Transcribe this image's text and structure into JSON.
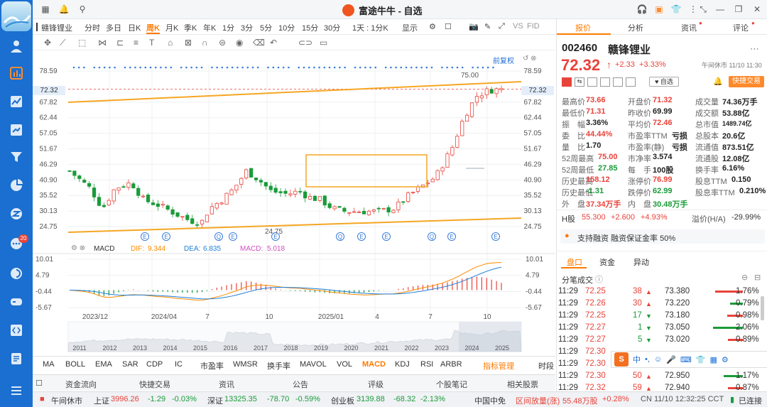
{
  "window": {
    "title": "富途牛牛 - 自选"
  },
  "rail": {
    "badge": "20"
  },
  "chart_toolbar": {
    "stock_name": "赣锋锂业",
    "periods": [
      "分时",
      "多日",
      "日K",
      "周K",
      "月K",
      "季K",
      "年K",
      "1分",
      "3分",
      "5分",
      "10分",
      "15分",
      "30分",
      "1天 : 1分K",
      "显示"
    ],
    "active_period": "周K",
    "vs": "VS",
    "fib": "FID"
  },
  "chart": {
    "restore_label": "前复权",
    "y_ticks": [
      "78.59",
      "67.82",
      "62.44",
      "57.05",
      "51.67",
      "46.29",
      "40.90",
      "35.52",
      "30.13",
      "24.75"
    ],
    "current_price_tag": "72.32",
    "max_label": "75.00",
    "min_label": "24.75",
    "event_marker": "E",
    "event_marker_alt": "Q",
    "macd": {
      "name": "MACD",
      "dif_label": "DIF:",
      "dif": "9.344",
      "dea_label": "DEA:",
      "dea": "6.835",
      "macd_label": "MACD:",
      "macd": "5.018",
      "ticks": [
        "10.01",
        "4.79",
        "-0.44",
        "-5.67"
      ]
    },
    "time_labels": [
      "2023/12",
      "2024/04",
      "7",
      "10",
      "2025/01",
      "4",
      "7",
      "10"
    ],
    "overview_years": [
      "2011",
      "2012",
      "2013",
      "2014",
      "2015",
      "2016",
      "2017",
      "2018",
      "2019",
      "2020",
      "2021",
      "2022",
      "2023",
      "2024",
      "2025"
    ]
  },
  "indicators": {
    "items": [
      "MA",
      "BOLL",
      "EMA",
      "SAR",
      "CDP",
      "IC",
      "市盈率",
      "WMSR",
      "换手率",
      "MAVOL",
      "VOL",
      "MACD",
      "KDJ",
      "RSI",
      "ARBR",
      "指标管理",
      "时段"
    ],
    "active": "MACD"
  },
  "bottom_nav": {
    "items": [
      "资金流向",
      "快捷交易",
      "资讯",
      "公告",
      "评级",
      "个股笔记",
      "相关股票"
    ]
  },
  "status": {
    "market_state": "午间休市",
    "sh_label": "上证",
    "sh": "3996.26",
    "sh_chg": "-1.29",
    "sh_pct": "-0.03%",
    "sz_label": "深证",
    "sz": "13325.35",
    "sz_chg": "-78.70",
    "sz_pct": "-0.59%",
    "cy_label": "创业板",
    "cy": "3139.88",
    "cy_chg": "-68.32",
    "cy_pct": "-2.13%",
    "fund_label": "中国中免",
    "fund_move": "区间放量(涨)",
    "fund_vol": "55.48万股",
    "fund_pct": "+0.28%",
    "clock": "CN 11/10 12:32:25 CCT",
    "conn": "已连接"
  },
  "right": {
    "tabs": [
      "报价",
      "分析",
      "资讯",
      "评论"
    ],
    "code": "002460",
    "name": "赣锋锂业",
    "price": "72.32",
    "arrow": "↑",
    "chg": "+2.33",
    "pct": "+3.33%",
    "session": "午间休市 11/10 11:30",
    "watch_label": "自选",
    "trade_label": "快捷交易",
    "quote_rows": [
      [
        [
          "最高价",
          "73.66",
          "red"
        ],
        [
          "开盘价",
          "71.32",
          "red"
        ],
        [
          "成交量",
          "74.36万手",
          "dark"
        ]
      ],
      [
        [
          "最低价",
          "71.31",
          "red"
        ],
        [
          "昨收价",
          "69.99",
          "dark"
        ],
        [
          "成交额",
          "53.88亿",
          "dark"
        ]
      ],
      [
        [
          "振　幅",
          "3.36%",
          "dark"
        ],
        [
          "平均价",
          "72.46",
          "red"
        ],
        [
          "总市值",
          "1489.74亿",
          "dark"
        ]
      ],
      [
        [
          "委　比",
          "44.44%",
          "red"
        ],
        [
          "市盈率TTM",
          "亏损",
          "dark"
        ],
        [
          "总股本",
          "20.6亿",
          "dark"
        ]
      ],
      [
        [
          "量　比",
          "1.70",
          "dark"
        ],
        [
          "市盈率(静)",
          "亏损",
          "dark"
        ],
        [
          "流通值",
          "873.51亿",
          "dark"
        ]
      ],
      [
        [
          "52周最高",
          "75.00",
          "red"
        ],
        [
          "市净率",
          "3.574",
          "dark"
        ],
        [
          "流通股",
          "12.08亿",
          "dark"
        ]
      ],
      [
        [
          "52周最低",
          "27.85",
          "green"
        ],
        [
          "每　手",
          "100股",
          "dark"
        ],
        [
          "换手率",
          "6.16%",
          "dark"
        ]
      ],
      [
        [
          "历史最高",
          "158.12",
          "red"
        ],
        [
          "涨停价",
          "76.99",
          "red"
        ],
        [
          "股息TTM",
          "0.150",
          "dark"
        ]
      ],
      [
        [
          "历史最低",
          "-1.31",
          "green"
        ],
        [
          "跌停价",
          "62.99",
          "green"
        ],
        [
          "股息率TTM",
          "0.210%",
          "dark"
        ]
      ],
      [
        [
          "外　盘",
          "37.34万手",
          "red"
        ],
        [
          "内　盘",
          "30.48万手",
          "green"
        ],
        [
          "",
          "",
          " "
        ]
      ]
    ],
    "h_label": "H股",
    "h_price": "55.300",
    "h_chg": "+2.600",
    "h_pct": "+4.93%",
    "premium_label": "溢价(H/A)",
    "premium": "-29.99%",
    "margin_text": "支持融资 融资保证金率 50%",
    "sub_tabs": [
      "盘口",
      "资金",
      "异动"
    ],
    "ticks_title": "分笔成交",
    "ticks": [
      {
        "t": "11:29",
        "p": "72.25",
        "v": "38",
        "d": "▲",
        "x": "73.380",
        "r": "1.76%"
      },
      {
        "t": "11:29",
        "p": "72.26",
        "v": "30",
        "d": "▲",
        "x": "73.220",
        "r": "0.79%"
      },
      {
        "t": "11:29",
        "p": "72.25",
        "v": "17",
        "d": "▼",
        "x": "73.180",
        "r": "0.98%"
      },
      {
        "t": "11:29",
        "p": "72.27",
        "v": "1",
        "d": "▼",
        "x": "73.050",
        "r": "2.06%"
      },
      {
        "t": "11:29",
        "p": "72.27",
        "v": "5",
        "d": "▼",
        "x": "73.020",
        "r": "0.89%"
      },
      {
        "t": "11:29",
        "p": "72.30",
        "v": "",
        "d": "",
        "x": "",
        "r": ""
      },
      {
        "t": "11:29",
        "p": "72.30",
        "v": "",
        "d": "",
        "x": "",
        "r": ""
      },
      {
        "t": "11:29",
        "p": "72.30",
        "v": "50",
        "d": "▲",
        "x": "72.950",
        "r": "1.17%"
      },
      {
        "t": "11:29",
        "p": "72.32",
        "v": "59",
        "d": "▲",
        "x": "72.940",
        "r": "0.87%"
      }
    ],
    "ime_label": "中"
  }
}
